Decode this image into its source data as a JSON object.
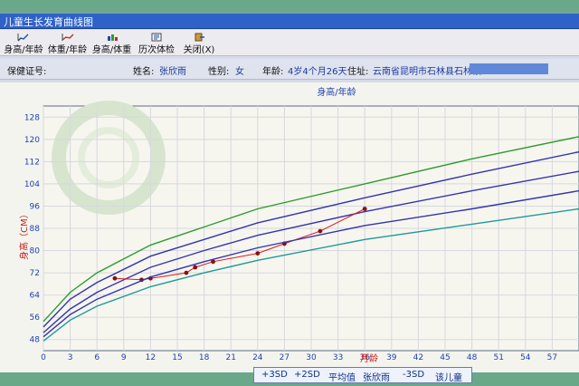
{
  "window": {
    "title": "儿童生长发育曲线图"
  },
  "toolbar": {
    "items": [
      {
        "label": "身高/年龄"
      },
      {
        "label": "体重/年龄"
      },
      {
        "label": "身高/体重"
      },
      {
        "label": "历次体检"
      },
      {
        "label": "关闭(X)"
      }
    ]
  },
  "info": {
    "health_card_label": "保健证号:",
    "name_label": "姓名:",
    "name_value": "张欣雨",
    "gender_label": "性别:",
    "gender_value": "女",
    "age_label": "年龄:",
    "age_value": "4岁4个月26天",
    "address_label": "住址:",
    "address_value": "云南省昆明市石林县石林镇"
  },
  "chart_data": {
    "type": "line",
    "title": "身高/年龄",
    "xlabel": "月龄",
    "ylabel": "身高（CM）",
    "xlim": [
      0,
      60
    ],
    "ylim": [
      44,
      132
    ],
    "x_ticks": [
      0,
      3,
      6,
      9,
      12,
      15,
      18,
      21,
      24,
      27,
      30,
      33,
      36,
      39,
      42,
      45,
      48,
      51,
      54,
      57
    ],
    "y_ticks": [
      48,
      56,
      64,
      72,
      80,
      88,
      96,
      104,
      112,
      120,
      128
    ],
    "grid": true,
    "legend_position": "bottom-center",
    "series": [
      {
        "name": "+3SD",
        "color": "#2f9b2f",
        "x": [
          0,
          3,
          6,
          12,
          18,
          24,
          36,
          48,
          60
        ],
        "y": [
          54.5,
          65,
          72,
          82,
          88.5,
          95,
          104,
          113,
          121
        ]
      },
      {
        "name": "+2SD",
        "color": "#3434b0",
        "x": [
          0,
          3,
          6,
          12,
          18,
          24,
          36,
          48,
          60
        ],
        "y": [
          52.5,
          62.5,
          68.5,
          78,
          84,
          90,
          99,
          107.5,
          115.5
        ]
      },
      {
        "name": "平均值",
        "color": "#3434b0",
        "x": [
          0,
          3,
          6,
          12,
          18,
          24,
          36,
          48,
          60
        ],
        "y": [
          50.5,
          59,
          65,
          74,
          80,
          85.5,
          94,
          101.5,
          108.5
        ]
      },
      {
        "name": "张欣雨",
        "color": "#d81c1c",
        "x": [
          8,
          11,
          12,
          16,
          17,
          19,
          24,
          27,
          31,
          36
        ],
        "y": [
          70,
          69.5,
          70,
          72,
          74,
          76,
          79,
          82.5,
          87,
          95
        ]
      },
      {
        "name": "-3SD",
        "color": "#1f9a9a",
        "x": [
          0,
          3,
          6,
          12,
          18,
          24,
          36,
          48,
          60
        ],
        "y": [
          47.5,
          55,
          60,
          67,
          72,
          76.5,
          84,
          89.5,
          95
        ]
      },
      {
        "name": "",
        "color": "#3434b0",
        "x": [
          0,
          3,
          6,
          12,
          18,
          24,
          36,
          48,
          60
        ],
        "y": [
          49,
          57,
          62.5,
          70.5,
          76,
          81,
          89,
          95,
          101.5
        ]
      }
    ],
    "legend": [
      "+3SD",
      "+2SD",
      "平均值",
      "张欣雨",
      "-3SD",
      "该儿童"
    ]
  }
}
